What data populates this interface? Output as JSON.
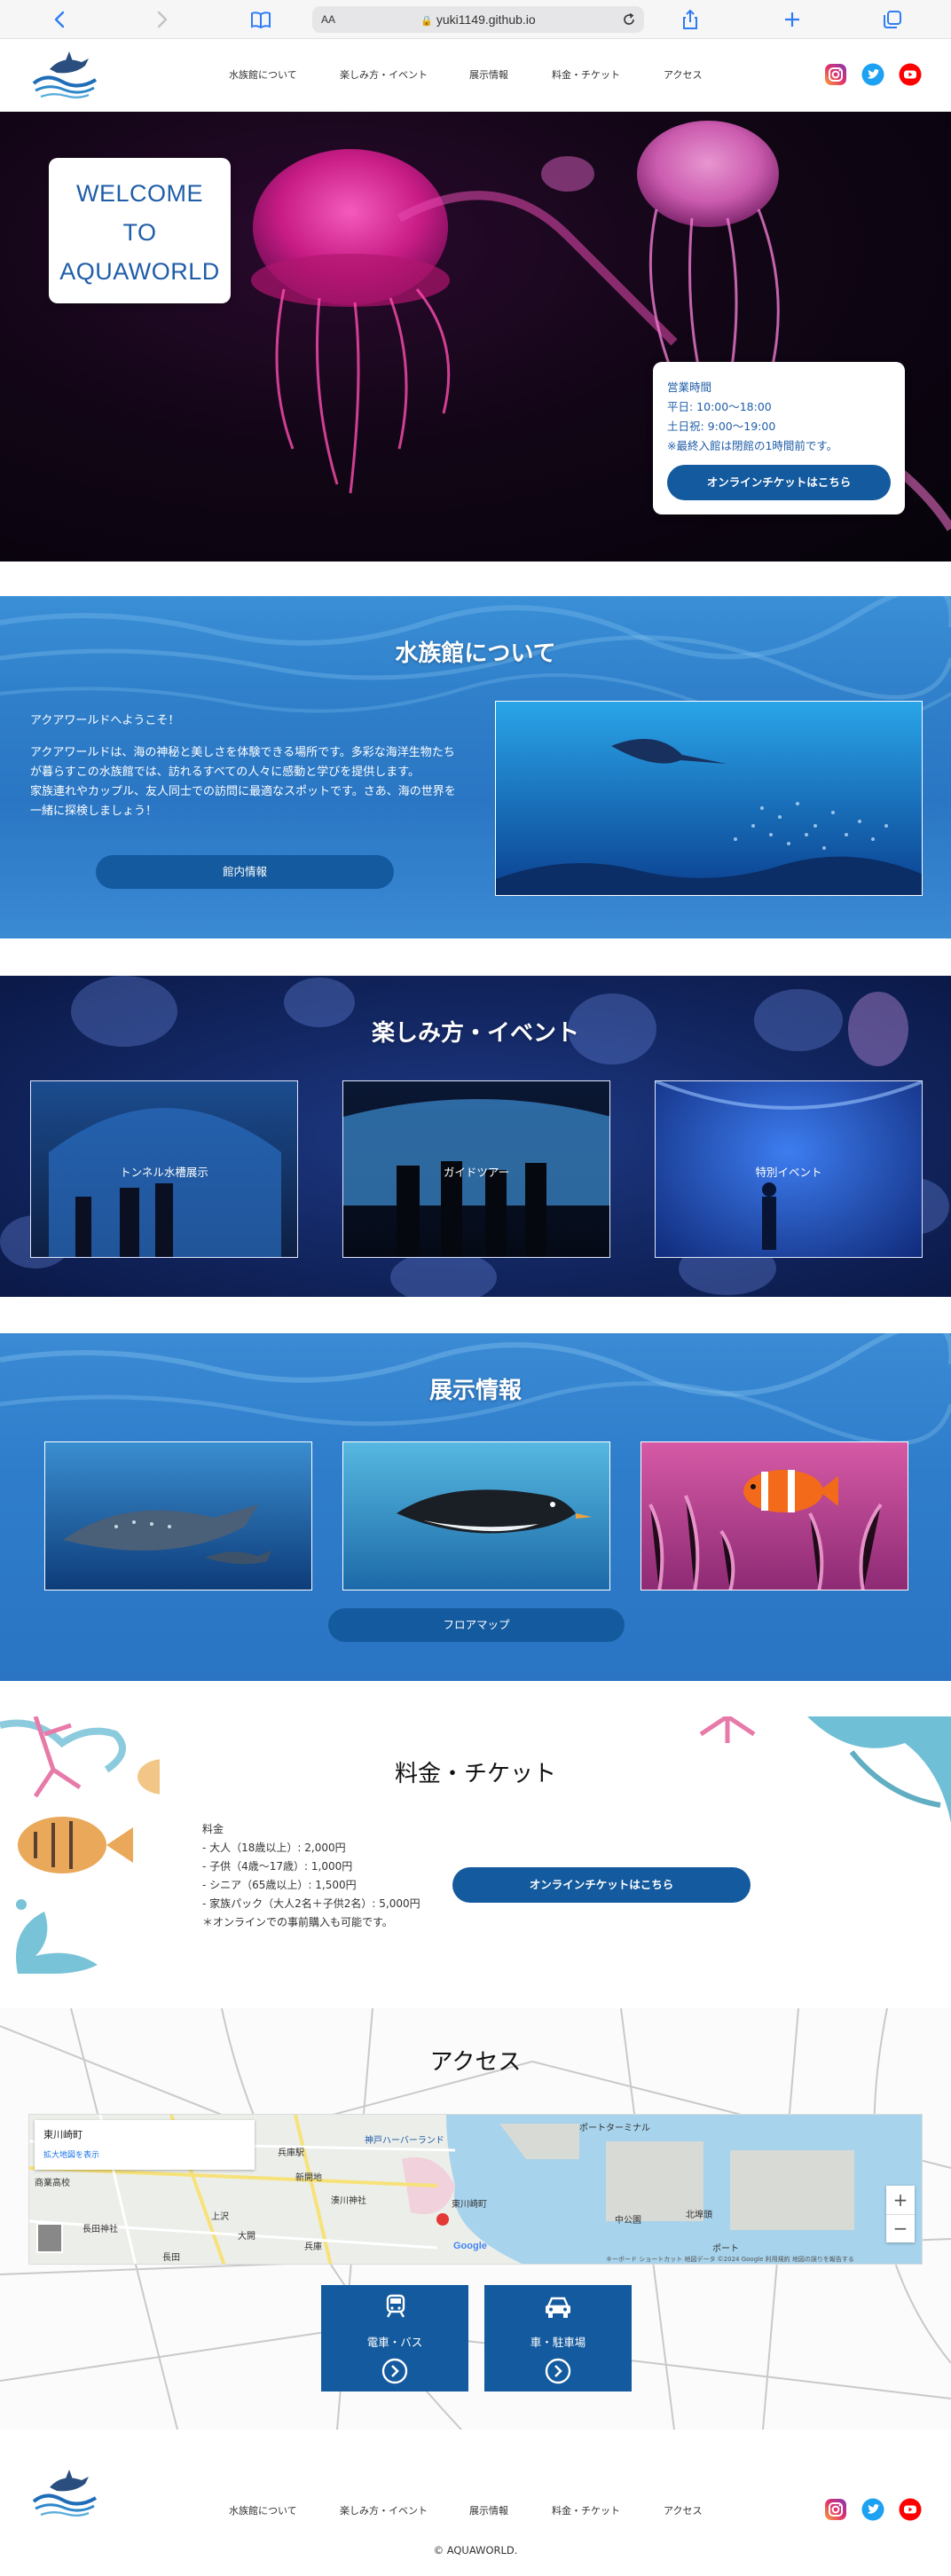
{
  "browser": {
    "text_size_label": "AA",
    "url": "yuki1149.github.io"
  },
  "header": {
    "nav": [
      "水族館について",
      "楽しみ方・イベント",
      "展示情報",
      "料金・チケット",
      "アクセス"
    ]
  },
  "hero": {
    "welcome_lines": [
      "WELCOME",
      "TO",
      "AQUAWORLD"
    ],
    "hours_title": "営業時間",
    "hours_weekday": "平日: 10:00〜18:00",
    "hours_weekend": "土日祝: 9:00〜19:00",
    "hours_note": "※最終入館は閉館の1時間前です。",
    "ticket_button": "オンラインチケットはこちら"
  },
  "about": {
    "title": "水族館について",
    "greeting": "アクアワールドへようこそ！",
    "body": "アクアワールドは、海の神秘と美しさを体験できる場所です。多彩な海洋生物たちが暮らすこの水族館では、訪れるすべての人々に感動と学びを提供します。",
    "body2": "家族連れやカップル、友人同士での訪問に最適なスポットです。さあ、海の世界を一緒に探検しましょう！",
    "button": "館内情報"
  },
  "events": {
    "title": "楽しみ方・イベント",
    "cards": [
      "トンネル水槽展示",
      "ガイドツアー",
      "特別イベント"
    ]
  },
  "exhibits": {
    "title": "展示情報",
    "button": "フロアマップ"
  },
  "tickets": {
    "title": "料金・チケット",
    "heading": "料金",
    "lines": [
      "- 大人（18歳以上）: 2,000円",
      "- 子供（4歳〜17歳）: 1,000円",
      "- シニア（65歳以上）: 1,500円",
      "- 家族パック（大人2名＋子供2名）: 5,000円",
      "＊オンラインでの事前購入も可能です。"
    ],
    "button": "オンラインチケットはこちら"
  },
  "access": {
    "title": "アクセス",
    "map_place": "東川崎町",
    "map_link": "拡大地図を表示",
    "map_labels": [
      "神戸ハーバーランド",
      "新開地",
      "湊川神社",
      "ポートターミナル",
      "中公園",
      "北埠頭",
      "長田神社",
      "上沢",
      "大開",
      "長田",
      "兵庫駅",
      "東川崎町",
      "ポート",
      "兵庫",
      "商業高校"
    ],
    "google_label": "Google",
    "map_footer": "キーボード ショートカット  地図データ ©2024 Google  利用規約  地図の誤りを報告する",
    "zoom_in": "+",
    "zoom_out": "−",
    "buttons": [
      "電車・バス",
      "車・駐車場"
    ]
  },
  "footer": {
    "nav": [
      "水族館について",
      "楽しみ方・イベント",
      "展示情報",
      "料金・チケット",
      "アクセス"
    ],
    "copyright": "© AQUAWORLD."
  },
  "colors": {
    "primary_blue": "#145a9e",
    "title_blue": "#1f5da8",
    "instagram": "#c13584",
    "twitter": "#1da1f2",
    "youtube": "#ff0000"
  },
  "icons": [
    "back-chevron-icon",
    "forward-chevron-icon",
    "book-icon",
    "reload-icon",
    "share-icon",
    "plus-icon",
    "tabs-icon",
    "instagram-icon",
    "twitter-icon",
    "youtube-icon",
    "train-icon",
    "car-icon",
    "arrow-circle-icon"
  ]
}
